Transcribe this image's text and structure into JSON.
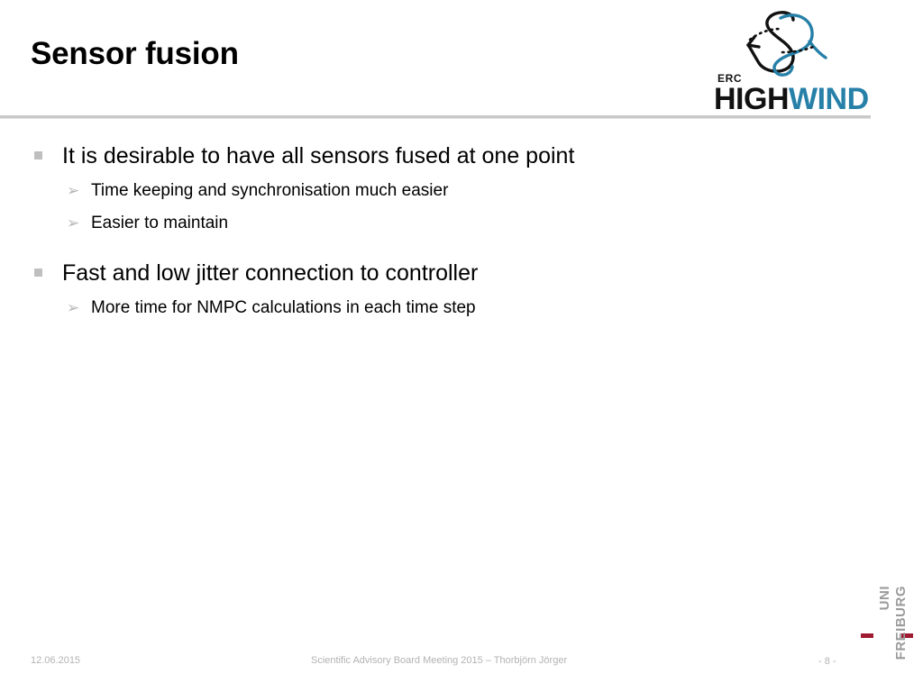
{
  "slide": {
    "title": "Sensor fusion",
    "page_number": "- 8 -"
  },
  "logo_highwind": {
    "erc": "ERC",
    "name_dark": "HIGH",
    "name_blue": "WIND",
    "blue_hex": "#2680a8",
    "dark_hex": "#111111"
  },
  "content": {
    "groups": [
      {
        "level1": "It is desirable to have all sensors fused at one point",
        "level2": [
          "Time keeping and synchronisation much easier",
          "Easier to maintain"
        ]
      },
      {
        "level1": "Fast and low jitter connection to controller",
        "level2": [
          "More time for NMPC calculations in each time step"
        ]
      }
    ],
    "marker_level1": "square",
    "marker_level2": "➢"
  },
  "footer": {
    "date": "12.06.2015",
    "center": "Scientific Advisory Board Meeting 2015 – Thorbjörn Jörger"
  },
  "logo_freiburg": {
    "line1": "UNI",
    "line2": "FREIBURG",
    "accent_hex": "#9e1b32",
    "text_hex": "#9b9b9b"
  }
}
